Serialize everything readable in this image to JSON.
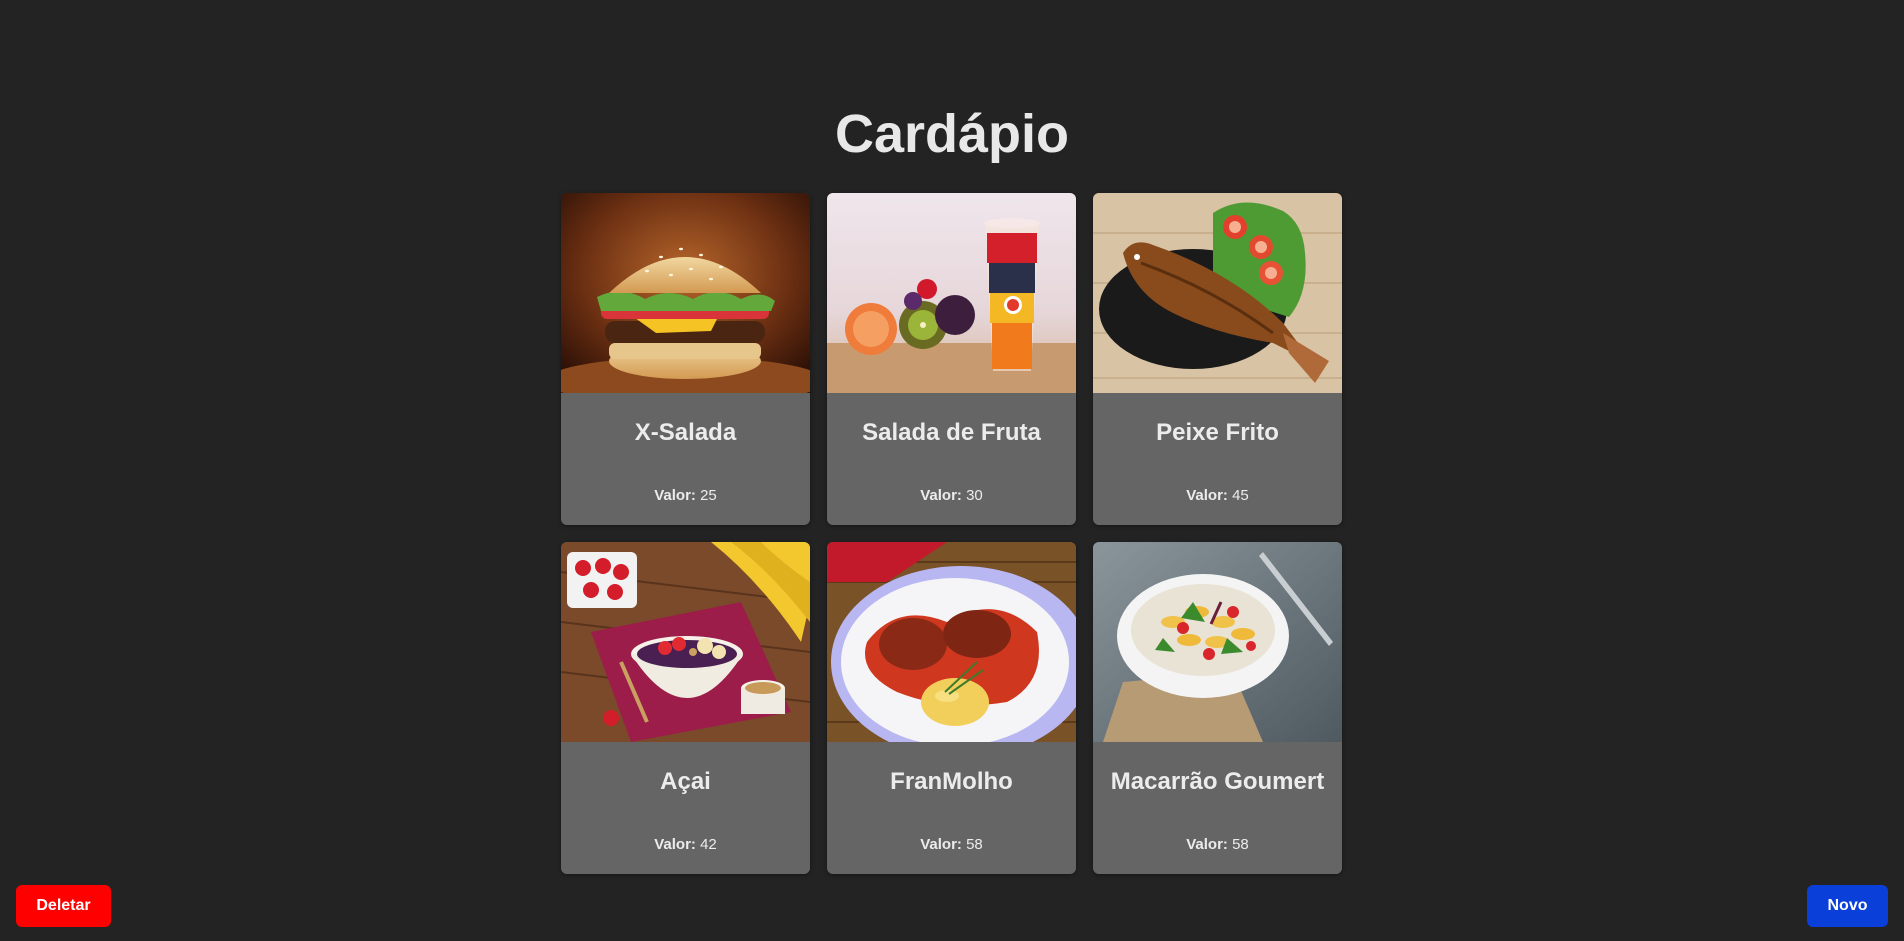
{
  "page": {
    "title": "Cardápio"
  },
  "menu": {
    "price_label": "Valor:",
    "items": [
      {
        "name": "X-Salada",
        "price": "25",
        "image": "burger-photo"
      },
      {
        "name": "Salada de Fruta",
        "price": "30",
        "image": "fruit-salad-cup-photo"
      },
      {
        "name": "Peixe Frito",
        "price": "45",
        "image": "fried-fish-photo"
      },
      {
        "name": "Açai",
        "price": "42",
        "image": "acai-bowl-photo"
      },
      {
        "name": "FranMolho",
        "price": "58",
        "image": "chicken-in-sauce-photo"
      },
      {
        "name": "Macarrão Goumert",
        "price": "58",
        "image": "pasta-salad-photo"
      }
    ]
  },
  "actions": {
    "delete_label": "Deletar",
    "new_label": "Novo"
  },
  "colors": {
    "background": "#232323",
    "card": "#656565",
    "delete": "#ff0000",
    "new": "#0a3fd9"
  }
}
